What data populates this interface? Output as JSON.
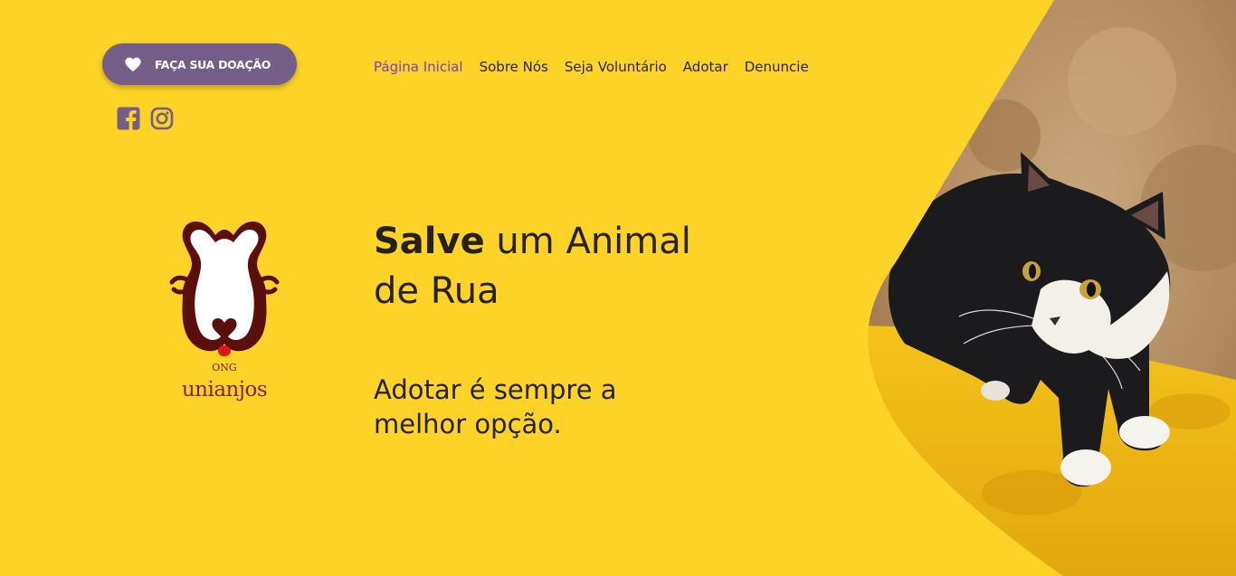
{
  "header": {
    "donate_label": "FAÇA SUA DOAÇÃO",
    "social": [
      {
        "icon": "facebook-icon"
      },
      {
        "icon": "instagram-icon"
      }
    ]
  },
  "nav": {
    "items": [
      {
        "label": "Página Inicial",
        "active": true
      },
      {
        "label": "Sobre Nós",
        "active": false
      },
      {
        "label": "Seja Voluntário",
        "active": false
      },
      {
        "label": "Adotar",
        "active": false
      },
      {
        "label": "Denuncie",
        "active": false
      }
    ]
  },
  "logo": {
    "ong": "ONG",
    "name": "unianjos",
    "icon": "bone-dog-logo-icon"
  },
  "hero": {
    "headline_bold": "Salve",
    "headline_rest": " um Animal de Rua",
    "subline": "Adotar é sempre a melhor opção.",
    "image": "black-and-white-cat-photo"
  },
  "colors": {
    "background": "#fdd327",
    "donate_button": "#745e88",
    "nav_active": "#7b3ec6",
    "text": "#26221b",
    "logo_red": "#7a1b12"
  }
}
